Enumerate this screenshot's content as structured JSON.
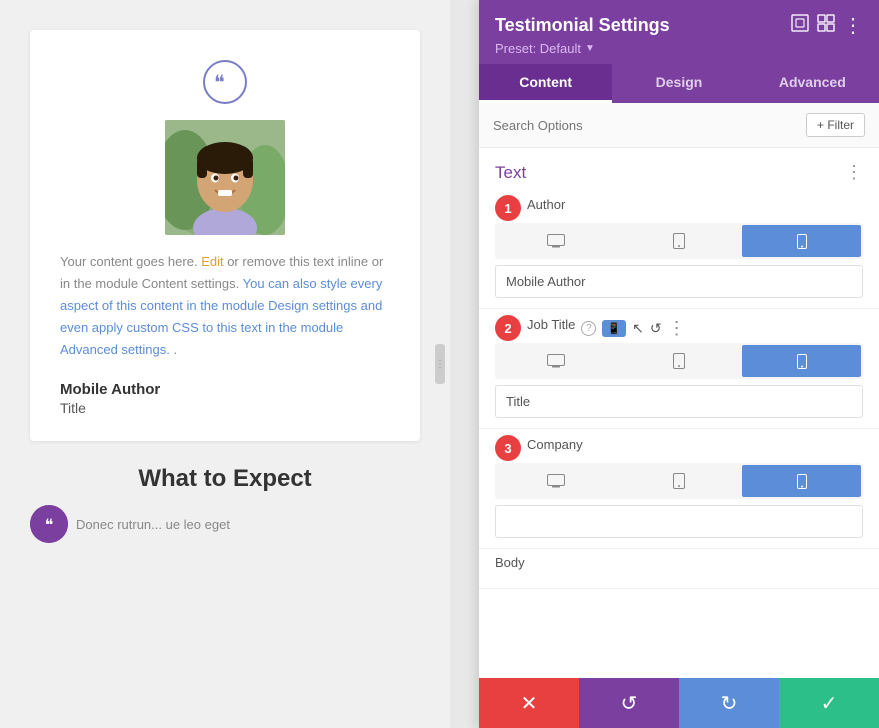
{
  "leftPanel": {
    "cardText": "Your content goes here. Edit or remove this text inline or in the module Content settings. You can also style every aspect of this content in the module Design settings and even apply custom CSS to this text in the module Advanced settings. .",
    "authorName": "Mobile Author",
    "authorTitle": "Title",
    "whatToExpect": "What to Expect",
    "bottomText": "Donec rutrun... ue leo eget"
  },
  "rightPanel": {
    "title": "Testimonial Settings",
    "preset": "Preset: Default",
    "tabs": [
      {
        "label": "Content",
        "active": true
      },
      {
        "label": "Design",
        "active": false
      },
      {
        "label": "Advanced",
        "active": false
      }
    ],
    "search": {
      "placeholder": "Search Options",
      "filterLabel": "+ Filter"
    },
    "sectionTitle": "Text",
    "fields": [
      {
        "label": "Author",
        "badge": "1",
        "inputValue": "Mobile Author"
      },
      {
        "label": "Job Title",
        "badge": "2",
        "inputValue": "Title"
      },
      {
        "label": "Company",
        "badge": "3",
        "inputValue": ""
      },
      {
        "label": "Body",
        "badge": null
      }
    ]
  },
  "bottomBar": {
    "cancel": "✕",
    "undo": "↺",
    "redo": "↻",
    "save": "✓"
  },
  "icons": {
    "desktop": "🖥",
    "tablet": "⬜",
    "mobile": "📱",
    "dots": "⋮",
    "help": "?",
    "cursor": "↖",
    "reset": "↺",
    "more": "⋮",
    "expand": "⤢",
    "grid": "⊞"
  }
}
